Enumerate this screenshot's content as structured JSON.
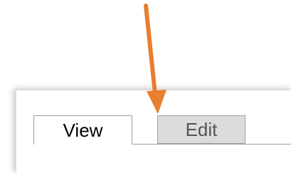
{
  "tabs": [
    {
      "label": "View",
      "selected": true
    },
    {
      "label": "Edit",
      "selected": false
    }
  ],
  "annotation": {
    "arrow_color": "#E87E2E",
    "points_to": "Edit"
  }
}
